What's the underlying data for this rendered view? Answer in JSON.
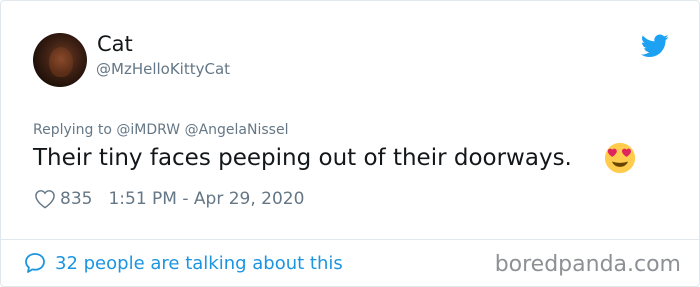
{
  "tweet": {
    "author": {
      "display_name": "Cat",
      "handle": "@MzHelloKittyCat"
    },
    "replying_to_label": "Replying to @iMDRW @AngelaNissel",
    "text": "Their tiny faces peeping out of their doorways.",
    "emoji_icon": "heart-eyes-emoji",
    "likes": "835",
    "timestamp": "1:51 PM - Apr 29, 2020"
  },
  "footer": {
    "talking_label": "32 people are talking about this",
    "watermark": "boredpanda.com"
  },
  "colors": {
    "accent": "#1b95e0",
    "secondary_text": "#657786",
    "primary_text": "#14171a",
    "border": "#e1e8ed"
  }
}
